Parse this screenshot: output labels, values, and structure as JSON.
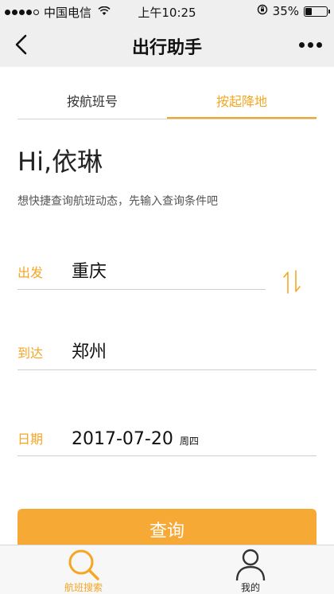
{
  "status": {
    "carrier": "中国电信",
    "time": "上午10:25",
    "battery": "35%",
    "battery_level": 0.35
  },
  "nav": {
    "title": "出行助手"
  },
  "tabs": [
    {
      "label": "按航班号",
      "active": false
    },
    {
      "label": "按起降地",
      "active": true
    }
  ],
  "greeting": "Hi,依琳",
  "subtitle": "想快捷查询航班动态，先输入查询条件吧",
  "form": {
    "departure": {
      "label": "出发",
      "value": "重庆"
    },
    "arrival": {
      "label": "到达",
      "value": "郑州"
    },
    "date": {
      "label": "日期",
      "value": "2017-07-20",
      "weekday": "周四"
    }
  },
  "query_button": "查询",
  "tabbar": [
    {
      "label": "航班搜索",
      "icon": "search-icon",
      "active": true
    },
    {
      "label": "我的",
      "icon": "user-icon",
      "active": false
    }
  ],
  "colors": {
    "accent": "#f5a623",
    "button": "#f7a935"
  }
}
